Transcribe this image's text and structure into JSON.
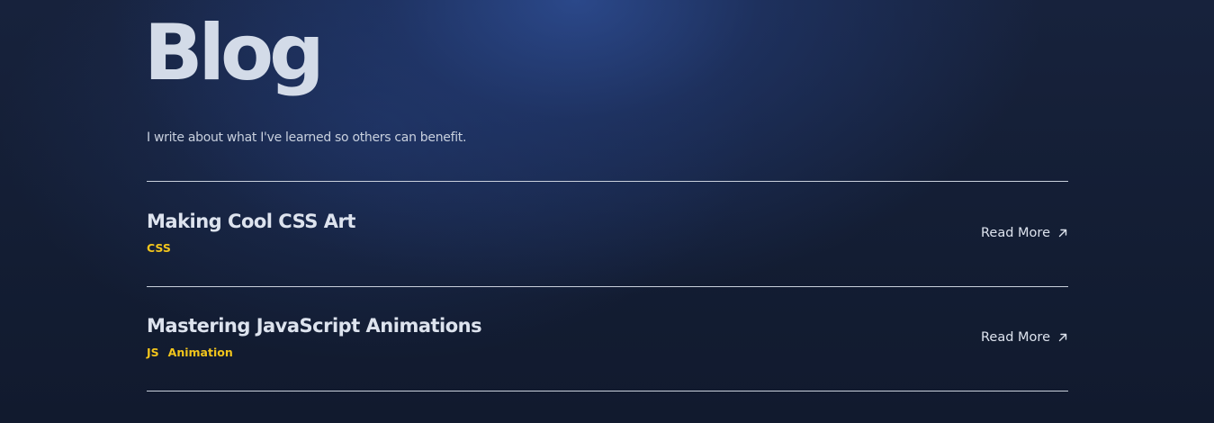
{
  "page": {
    "title": "Blog",
    "subtitle": "I write about what I've learned so others can benefit."
  },
  "posts": [
    {
      "title": "Making Cool CSS Art",
      "tags": [
        "CSS"
      ],
      "read_more": "Read More",
      "icon": "arrow-up-right-icon"
    },
    {
      "title": "Mastering JavaScript Animations",
      "tags": [
        "JS",
        "Animation"
      ],
      "read_more": "Read More",
      "icon": "arrow-up-right-icon"
    }
  ],
  "colors": {
    "background": "#131d33",
    "accent_glow": "#2e4e96",
    "tag": "#f2c51c",
    "text": "#dde3ee"
  }
}
